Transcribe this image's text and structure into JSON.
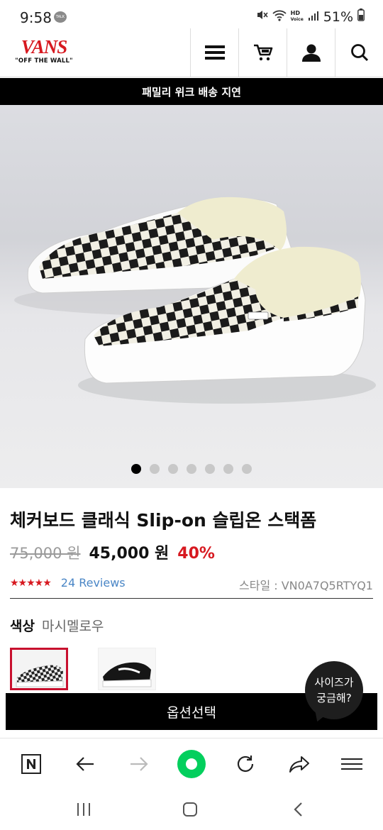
{
  "status_bar": {
    "time": "9:58",
    "talk_badge": "TALK",
    "hd_label": "HD",
    "hd_sub": "Voice",
    "battery": "51%"
  },
  "header": {
    "brand": "VANS",
    "tagline": "\"OFF THE WALL\"",
    "icons": [
      "menu-icon",
      "cart-icon",
      "user-icon",
      "search-icon"
    ]
  },
  "banner": {
    "text": "패밀리 위크 배송 지연"
  },
  "gallery": {
    "total": 7,
    "active_index": 0
  },
  "product": {
    "title": "체커보드 클래식 Slip-on 슬립온 스택폼",
    "original_price": "75,000 원",
    "sale_price": "45,000 원",
    "discount": "40%",
    "rating_stars": "★★★★★",
    "rating": 4.5,
    "reviews": "24 Reviews",
    "style_code": "스타일 : VN0A7Q5RTYQ1",
    "color_label": "색상",
    "color_value": "마시멜로우"
  },
  "actions": {
    "option_select": "옵션선택",
    "size_help": [
      "사이즈가",
      "궁금해?"
    ]
  },
  "colors": {
    "accent_red": "#d71920",
    "link_blue": "#4a86c6",
    "browser_green": "#03cf5d"
  }
}
